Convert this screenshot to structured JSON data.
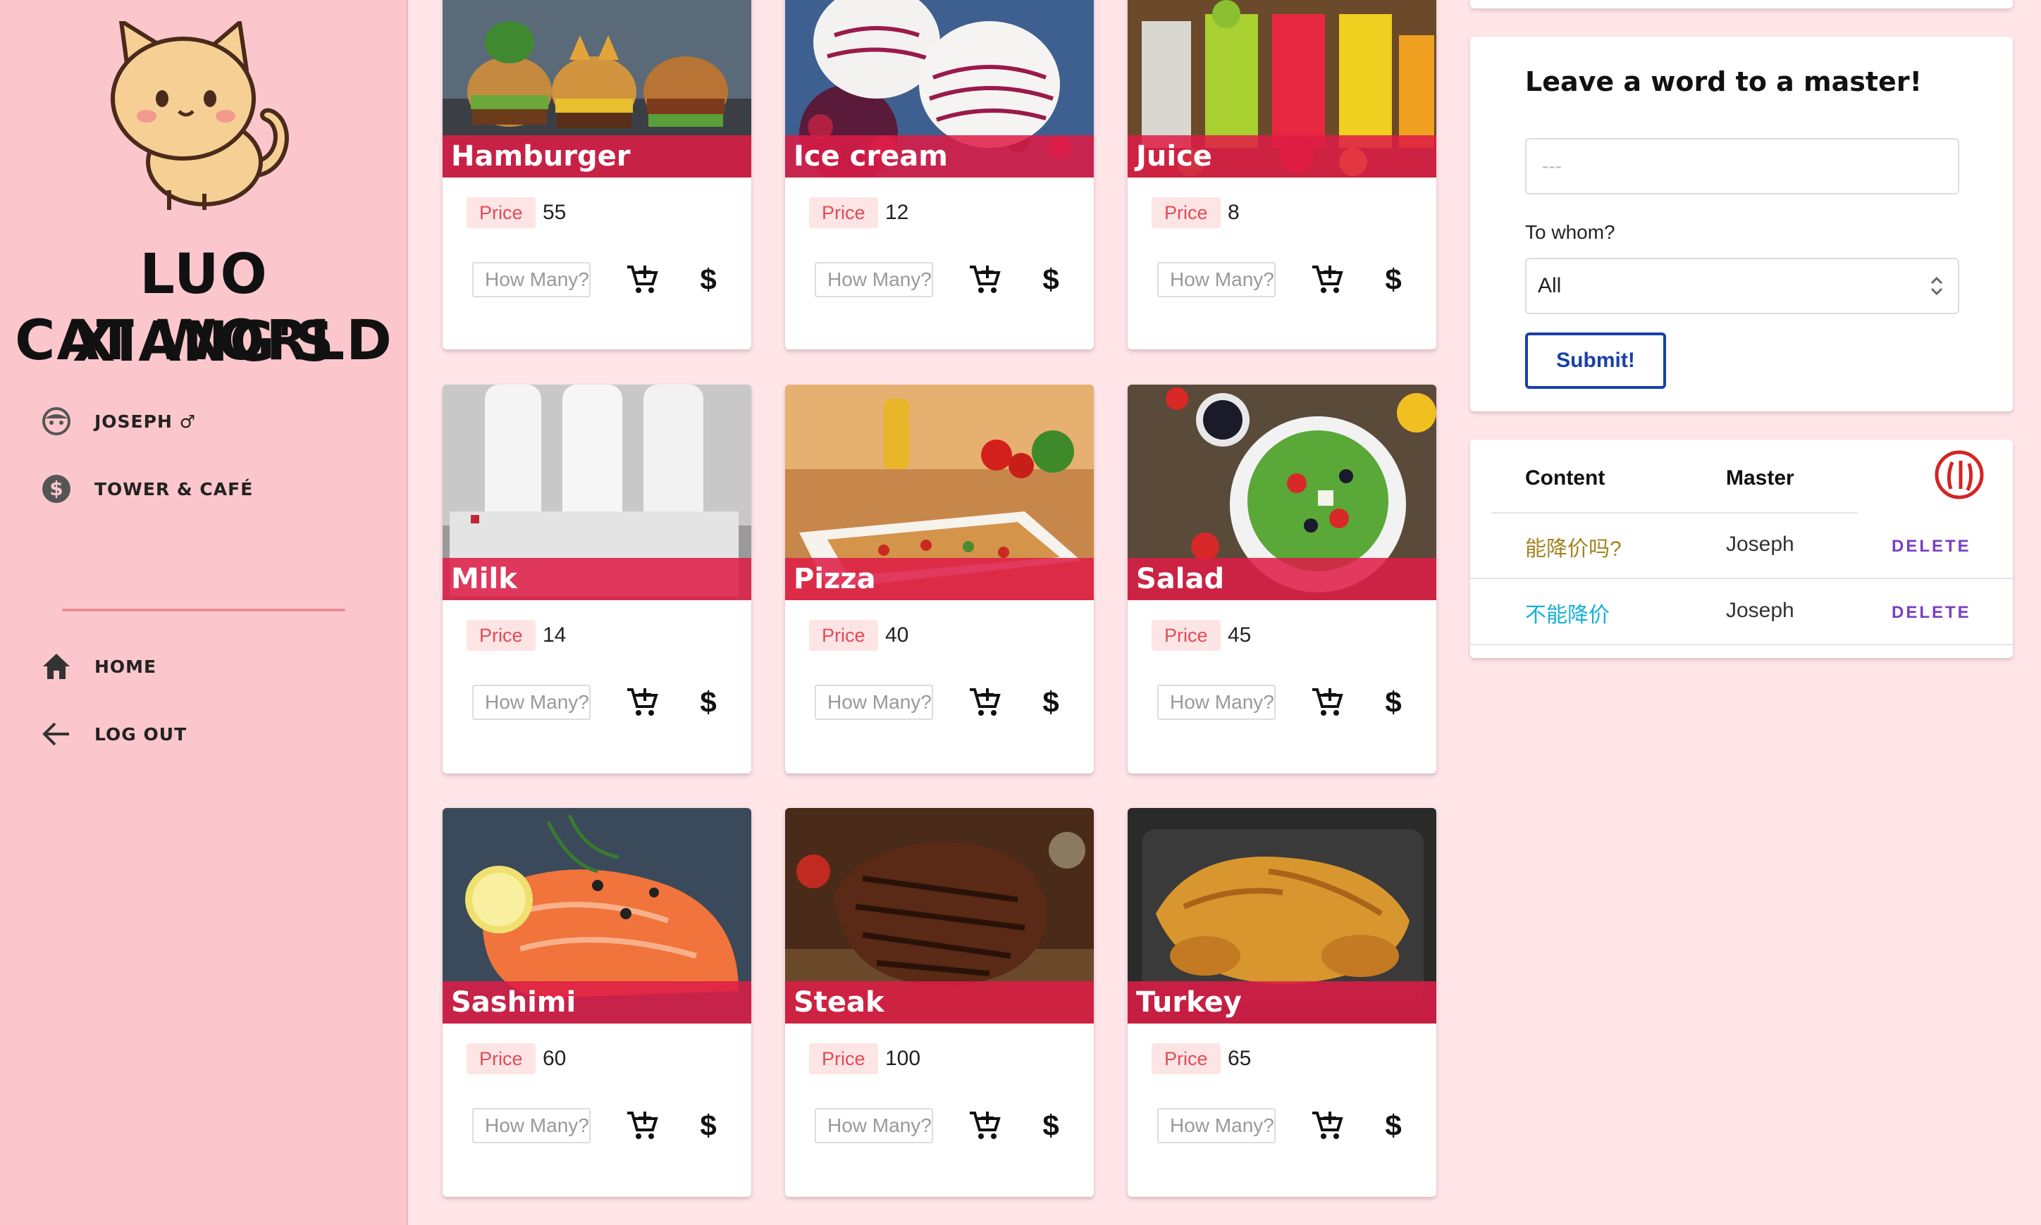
{
  "sidebar": {
    "brand_line1": "LUO XIANG'S",
    "brand_line2": "CAT WORLD",
    "user_name": "JOSEPH ♂",
    "shop_name": "TOWER & CAFÉ",
    "nav": [
      {
        "label": "HOME",
        "icon": "home-icon"
      },
      {
        "label": "LOG OUT",
        "icon": "arrow-left-icon"
      }
    ]
  },
  "products": [
    {
      "name": "Hamburger",
      "price_label": "Price",
      "price": "55",
      "qty_placeholder": "How Many?"
    },
    {
      "name": "Ice cream",
      "price_label": "Price",
      "price": "12",
      "qty_placeholder": "How Many?"
    },
    {
      "name": "Juice",
      "price_label": "Price",
      "price": "8",
      "qty_placeholder": "How Many?"
    },
    {
      "name": "Milk",
      "price_label": "Price",
      "price": "14",
      "qty_placeholder": "How Many?"
    },
    {
      "name": "Pizza",
      "price_label": "Price",
      "price": "40",
      "qty_placeholder": "How Many?"
    },
    {
      "name": "Salad",
      "price_label": "Price",
      "price": "45",
      "qty_placeholder": "How Many?"
    },
    {
      "name": "Sashimi",
      "price_label": "Price",
      "price": "60",
      "qty_placeholder": "How Many?"
    },
    {
      "name": "Steak",
      "price_label": "Price",
      "price": "100",
      "qty_placeholder": "How Many?"
    },
    {
      "name": "Turkey",
      "price_label": "Price",
      "price": "65",
      "qty_placeholder": "How Many?"
    }
  ],
  "message_form": {
    "title": "Leave a word to a master!",
    "placeholder": "---",
    "to_label": "To whom?",
    "to_value": "All",
    "submit_label": "Submit!"
  },
  "messages_table": {
    "headers": {
      "content": "Content",
      "master": "Master"
    },
    "rows": [
      {
        "content": "能降价吗?",
        "master": "Joseph",
        "action": "DELETE"
      },
      {
        "content": "不能降价",
        "master": "Joseph",
        "action": "DELETE"
      }
    ]
  },
  "colors": {
    "sidebar_bg": "#fcc7cc",
    "page_bg": "#ffe4e8",
    "banner": "#de1c46",
    "submit_blue": "#1a3fa8",
    "delete_purple": "#7a3fc0"
  }
}
